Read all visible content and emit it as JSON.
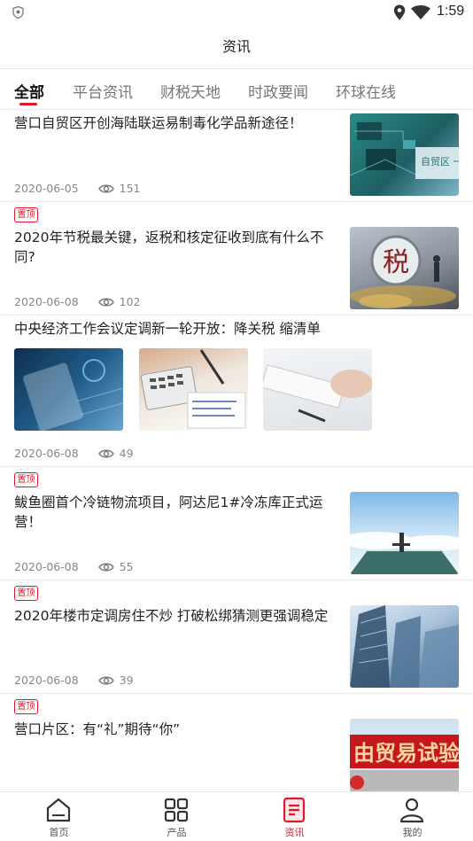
{
  "status_bar": {
    "time": "1:59"
  },
  "header": {
    "title": "资讯"
  },
  "tabs": [
    {
      "label": "全部",
      "active": true
    },
    {
      "label": "平台资讯"
    },
    {
      "label": "财税天地"
    },
    {
      "label": "时政要闻"
    },
    {
      "label": "环球在线"
    }
  ],
  "articles": [
    {
      "title": "营口自贸区开创海陆联运易制毒化学品新途径！",
      "date": "2020-06-05",
      "views": "151",
      "image": "circuit-board-image",
      "thumb_text": "自贸区 一站式服"
    },
    {
      "badge": "置顶",
      "title": "2020年节税最关键，返税和核定征收到底有什么不同?",
      "date": "2020-06-08",
      "views": "102",
      "image": "tax-coins-image",
      "thumb_text": "税"
    },
    {
      "title": "中央经济工作会议定调新一轮开放：降关税 缩清单",
      "date": "2020-06-08",
      "views": "49",
      "images": [
        "tablet-data-image",
        "calculator-document-image",
        "keyboard-hand-image"
      ]
    },
    {
      "badge": "置顶",
      "title": "鲅鱼圈首个冷链物流项目，阿达尼1#冷冻库正式运营！",
      "date": "2020-06-08",
      "views": "55",
      "image": "building-roof-clouds-image"
    },
    {
      "badge": "置顶",
      "title": "2020年楼市定调房住不炒 打破松绑猜测更强调稳定",
      "date": "2020-06-08",
      "views": "39",
      "image": "skyscrapers-image"
    },
    {
      "badge": "置顶",
      "title": "营口片区：有“礼”期待“你”",
      "image": "free-trade-zone-sign-image",
      "thumb_text": "由贸易试验"
    }
  ],
  "bottom_nav": [
    {
      "label": "首页",
      "icon": "home-icon"
    },
    {
      "label": "产品",
      "icon": "grid-icon"
    },
    {
      "label": "资讯",
      "icon": "document-icon",
      "active": true
    },
    {
      "label": "我的",
      "icon": "person-icon"
    }
  ],
  "colors": {
    "accent": "#e0162b",
    "text": "#222222",
    "meta": "#888888"
  }
}
